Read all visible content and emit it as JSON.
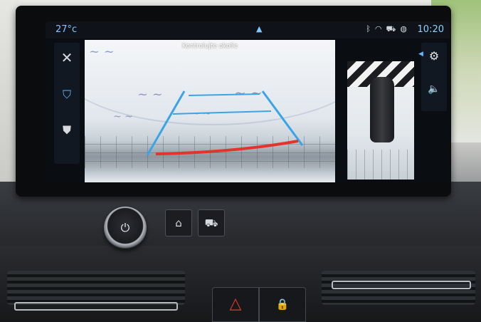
{
  "status_bar": {
    "temperature": "27°c",
    "time": "10:20",
    "home_indicator_icon": "home-icon",
    "status_icons": [
      "bluetooth-icon",
      "wifi-icon",
      "car-icon",
      "signal-icon"
    ]
  },
  "camera": {
    "warning_text": "Kontrolujte okolie",
    "guide_colors": {
      "side_lines": "#3aa5e6",
      "near_line": "#e0342c"
    }
  },
  "left_menu": {
    "items": [
      "close-icon",
      "rear-camera-view-icon",
      "camera-alt-view-icon"
    ]
  },
  "right_menu": {
    "items": [
      "settings-gear-icon",
      "volume-icon"
    ]
  },
  "hardware": {
    "buttons": [
      "power-knob",
      "home-button",
      "car-button",
      "hazard-button",
      "lock-button"
    ]
  }
}
